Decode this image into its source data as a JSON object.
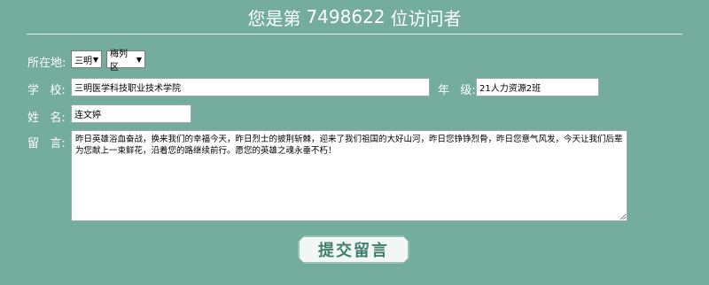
{
  "header": {
    "prefix": "您是第",
    "count": "7498622",
    "suffix": "位访问者"
  },
  "form": {
    "location_label": "所在地:",
    "city_value": "三明",
    "district_value": "梅列区",
    "school_label": "学   校:",
    "school_value": "三明医学科技职业技术学院",
    "grade_label": "年   级:",
    "grade_value": "21人力资源2班",
    "name_label": "姓   名:",
    "name_value": "连文婷",
    "message_label": "留   言:",
    "message_value": "昨日英雄浴血奋战，换来我们的幸福今天，昨日烈士的披荆斩棘，迎来了我们祖国的大好山河，昨日您铮铮烈骨，昨日您意气风发，今天让我们后辈为您献上一束鲜花，沿着您的路继续前行。愿您的英雄之魂永垂不朽！",
    "submit_label": "提交留言"
  }
}
